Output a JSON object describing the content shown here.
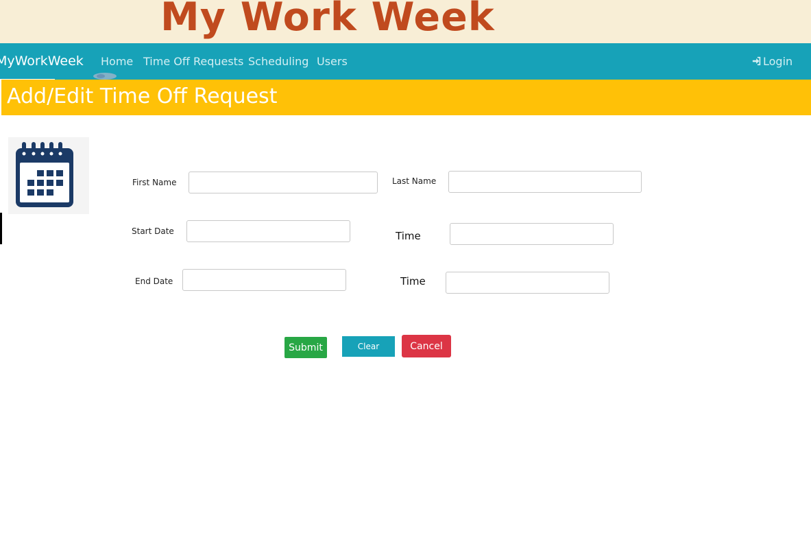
{
  "banner": {
    "title": "My Work Week"
  },
  "navbar": {
    "brand": "MyWorkWeek",
    "links": [
      {
        "label": "Home"
      },
      {
        "label": "Time Off Requests"
      },
      {
        "label": "Scheduling"
      },
      {
        "label": "Users"
      }
    ],
    "login": {
      "label": "Login",
      "icon": "sign-in-icon"
    }
  },
  "page": {
    "title": "Add/Edit Time Off Request",
    "icon": "calendar-icon"
  },
  "form": {
    "first_name": {
      "label": "First Name",
      "value": ""
    },
    "last_name": {
      "label": "Last Name",
      "value": ""
    },
    "start_date": {
      "label": "Start Date",
      "value": ""
    },
    "start_time": {
      "label": "Time",
      "value": ""
    },
    "end_date": {
      "label": "End Date",
      "value": ""
    },
    "end_time": {
      "label": "Time",
      "value": ""
    }
  },
  "buttons": {
    "submit": "Submit",
    "clear": "Clear",
    "cancel": "Cancel"
  },
  "colors": {
    "banner_bg": "#f8eed6",
    "banner_text": "#c04a1e",
    "navbar": "#17a2b8",
    "title_bar": "#ffc107",
    "submit": "#28a745",
    "clear": "#17a2b8",
    "cancel": "#dc3545",
    "calendar_icon": "#1b3a66"
  }
}
